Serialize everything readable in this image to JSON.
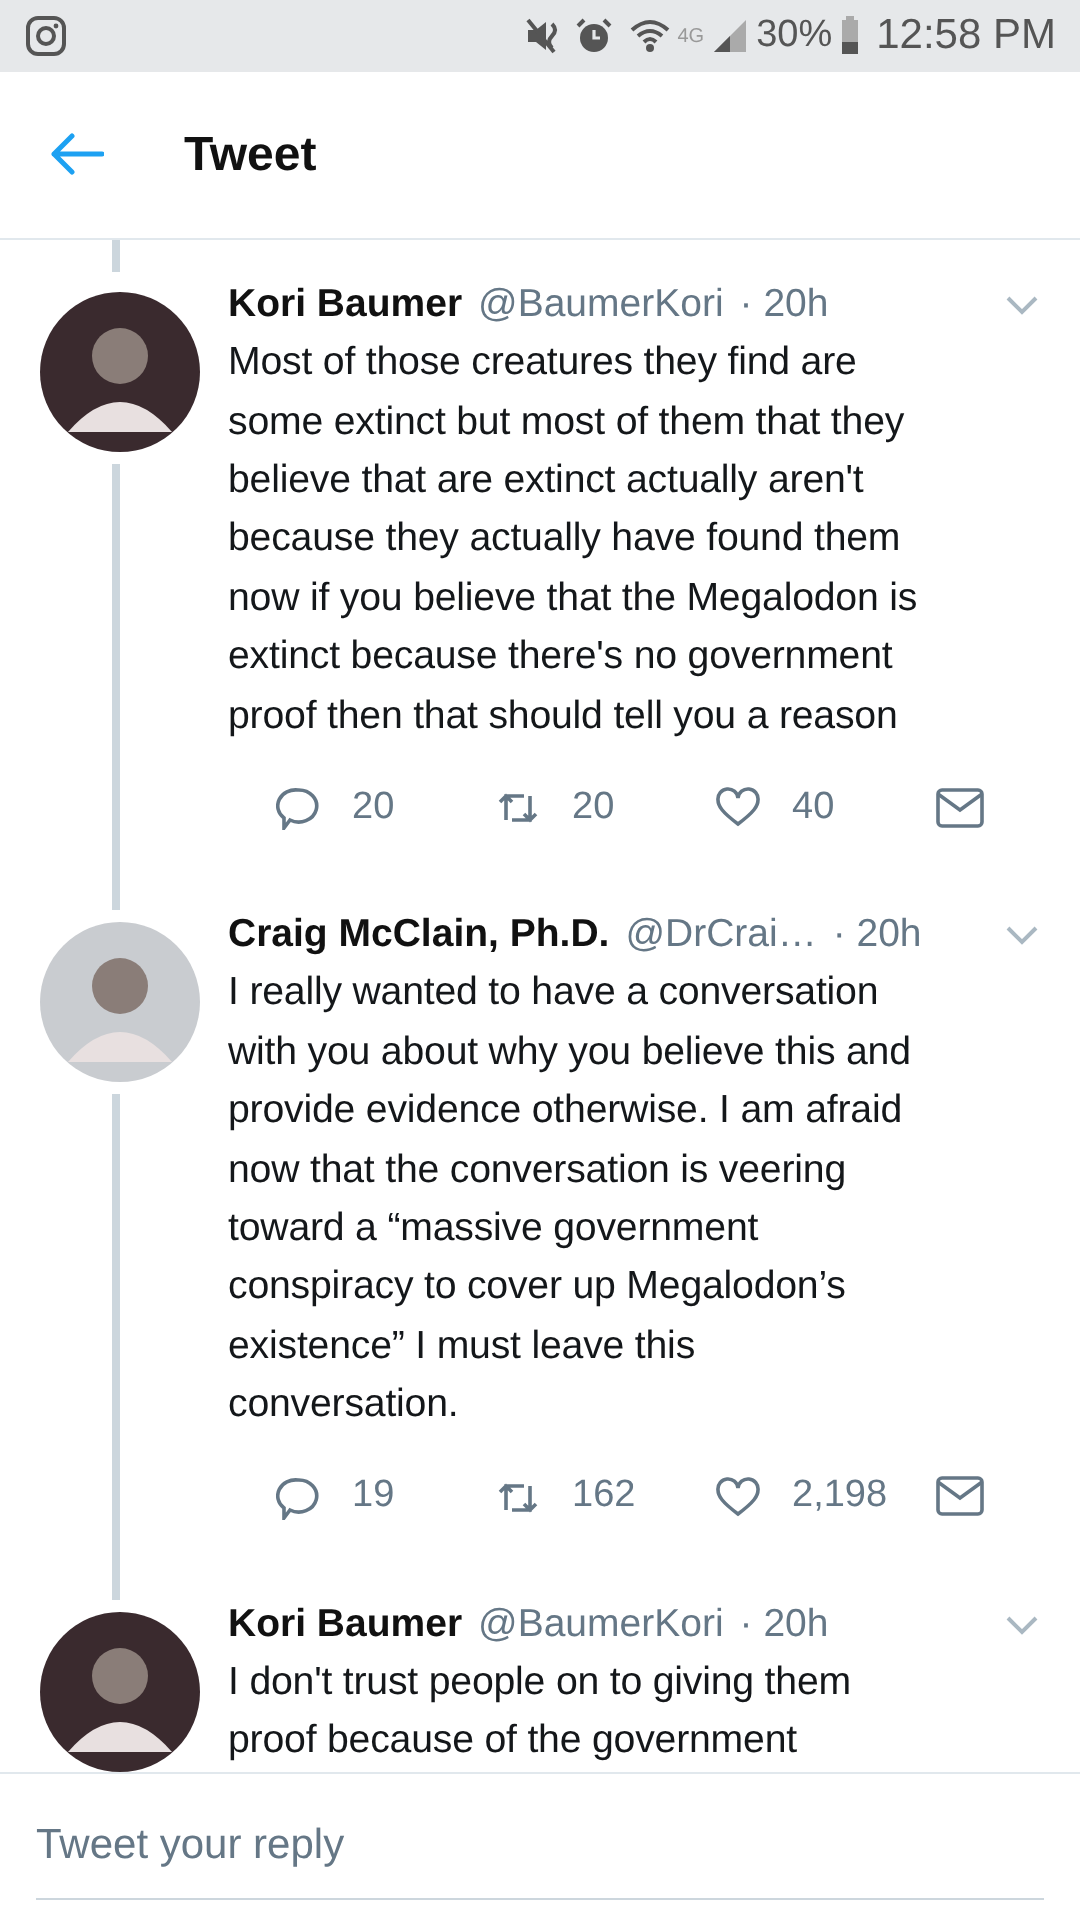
{
  "status_bar": {
    "battery": "30%",
    "time": "12:58 PM",
    "network": "4G"
  },
  "header": {
    "title": "Tweet"
  },
  "tweets": [
    {
      "name": "Kori Baumer",
      "handle": "@BaumerKori",
      "time": "· 20h",
      "color": "#3a2a2e",
      "lines": [
        "Most of those creatures they find are",
        "some extinct but most of them that they",
        "believe that are extinct actually aren't",
        "because they actually have found them",
        "now if you believe that the Megalodon is",
        "extinct because there's no government",
        "proof then that should tell you a reason"
      ],
      "replies": "20",
      "retweets": "20",
      "likes": "40"
    },
    {
      "name": "Craig McClain, Ph.D.",
      "handle": "@DrCrai…",
      "time": "· 20h",
      "color": "#c9ccd0",
      "lines": [
        "I really wanted to have a conversation",
        "with you about why you believe this and",
        "provide evidence otherwise.  I am afraid",
        "now that the conversation is veering",
        "toward a “massive government",
        "conspiracy to cover up Megalodon’s",
        "existence” I must leave this",
        "conversation."
      ],
      "replies": "19",
      "retweets": "162",
      "likes": "2,198"
    },
    {
      "name": "Kori Baumer",
      "handle": "@BaumerKori",
      "time": "· 20h",
      "color": "#3a2a2e",
      "lines": [
        "I don't trust people on to giving them",
        "proof because of the government"
      ]
    }
  ],
  "reply_box": {
    "placeholder": "Tweet your reply"
  }
}
